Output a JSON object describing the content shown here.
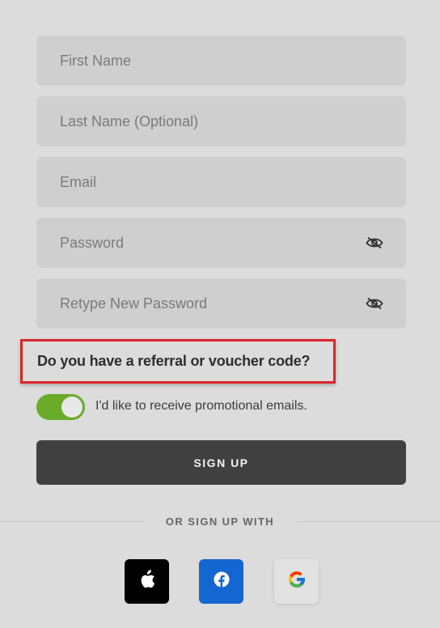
{
  "form": {
    "first_name_placeholder": "First Name",
    "last_name_placeholder": "Last Name (Optional)",
    "email_placeholder": "Email",
    "password_placeholder": "Password",
    "retype_password_placeholder": "Retype New Password",
    "password_toggle_icon": "eye-slash-icon"
  },
  "referral": {
    "label": "Do you have a referral or voucher code?",
    "highlight_color": "#d9262c"
  },
  "promo": {
    "label": "I'd like to receive promotional emails.",
    "enabled": true,
    "toggle_color": "#6aab2a"
  },
  "signup_button": {
    "label": "SIGN UP"
  },
  "social": {
    "divider_label": "OR SIGN UP WITH",
    "providers": [
      {
        "name": "Apple",
        "icon": "apple-icon"
      },
      {
        "name": "Facebook",
        "icon": "facebook-icon"
      },
      {
        "name": "Google",
        "icon": "google-icon"
      }
    ]
  }
}
